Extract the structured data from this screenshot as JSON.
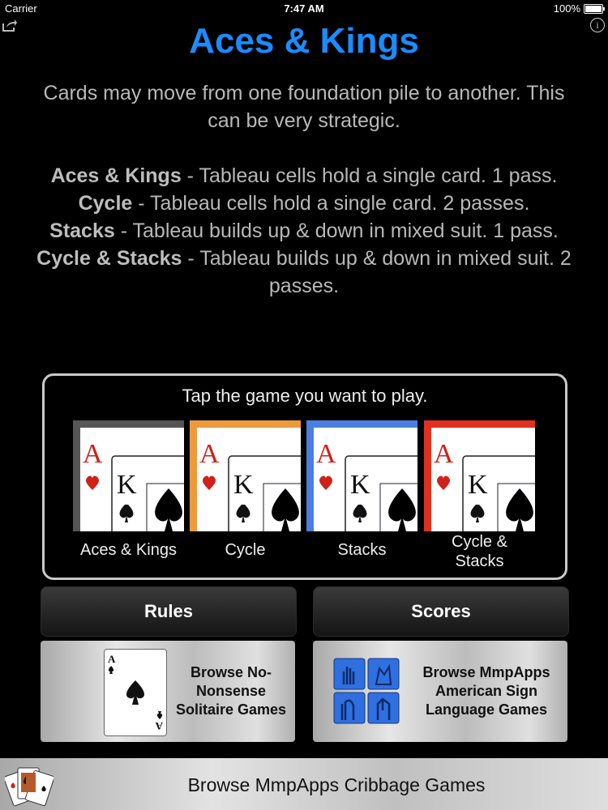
{
  "status_bar": {
    "carrier": "Carrier",
    "time": "7:47 AM",
    "battery": "100%"
  },
  "icons": {
    "share": "share-icon",
    "info": "info-icon",
    "info_glyph": "i"
  },
  "title": "Aces & Kings",
  "description": {
    "intro": "Cards may move from one foundation pile to another. This can be very strategic.",
    "rules": [
      {
        "name": "Aces & Kings",
        "text": " - Tableau cells hold a single card. 1 pass."
      },
      {
        "name": "Cycle",
        "text": " - Tableau cells hold a single card. 2 passes."
      },
      {
        "name": "Stacks",
        "text": " - Tableau builds up & down in mixed suit. 1 pass."
      },
      {
        "name": "Cycle & Stacks",
        "text": " - Tableau builds up & down in mixed suit. 2 passes."
      }
    ]
  },
  "game_picker": {
    "prompt": "Tap the game you want to play.",
    "games": [
      {
        "label": "Aces & Kings",
        "color": "#555555"
      },
      {
        "label": "Cycle",
        "color": "#ec9a3c"
      },
      {
        "label": "Stacks",
        "color": "#4a7fe0"
      },
      {
        "label_line1": "Cycle &",
        "label_line2": "Stacks",
        "color": "#e0301e"
      }
    ],
    "card_ranks": {
      "ace": "A",
      "king": "K"
    }
  },
  "buttons": {
    "rules": "Rules",
    "scores": "Scores"
  },
  "promos": {
    "solitaire": {
      "line1": "Browse No-",
      "line2": "Nonsense",
      "line3": "Solitaire Games",
      "card_rank": "A"
    },
    "asl": {
      "line1": "Browse MmpApps",
      "line2": "American Sign",
      "line3": "Language Games"
    },
    "cribbage": "Browse MmpApps Cribbage Games"
  }
}
